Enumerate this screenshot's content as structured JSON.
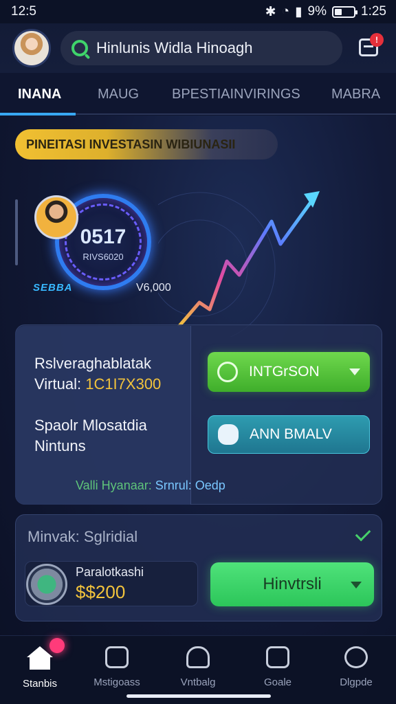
{
  "status_bar": {
    "time_left": "12:5",
    "battery": "9%",
    "time_right": "1:25"
  },
  "header": {
    "search_text": "Hinlunis Widla Hinoagh",
    "notification_badge": "!"
  },
  "tabs": [
    "INANA",
    "MAUG",
    "BPESTIAINVIRINGS",
    "MABRA"
  ],
  "promo": {
    "text": "PINEITASI INVESTASIN WIBIUNASII"
  },
  "hero": {
    "dial_value": "0517",
    "dial_sub": "RIVS6020",
    "brand": "SEBBA",
    "amount": "V6,000"
  },
  "card1": {
    "line1": "Rslveraghablatak",
    "line2_label": "Virtual:",
    "line2_value": "1C1I7X300",
    "line3": "Spaolr Mlosatdia",
    "line4": "Nintuns",
    "footer_left": "Valli Hyanaar:",
    "footer_right": "Srnrul: Oedp",
    "button1": "INTGrSON",
    "button2": "ANN BMALV"
  },
  "card2": {
    "title": "Minvak: Sglridial",
    "coin_label": "Paralotkashi",
    "coin_amount": "$$200",
    "button": "Hinvtrsli"
  },
  "bottom_nav": [
    {
      "label": "Stanbis",
      "icon": "home-icon"
    },
    {
      "label": "Mstigoass",
      "icon": "wallet-icon"
    },
    {
      "label": "Vntbalg",
      "icon": "bell-icon"
    },
    {
      "label": "Goale",
      "icon": "goal-icon"
    },
    {
      "label": "Dlgpde",
      "icon": "profile-icon"
    }
  ],
  "colors": {
    "accent_blue": "#38a8f2",
    "accent_green": "#3fd46b",
    "accent_gold": "#f2c33c"
  }
}
